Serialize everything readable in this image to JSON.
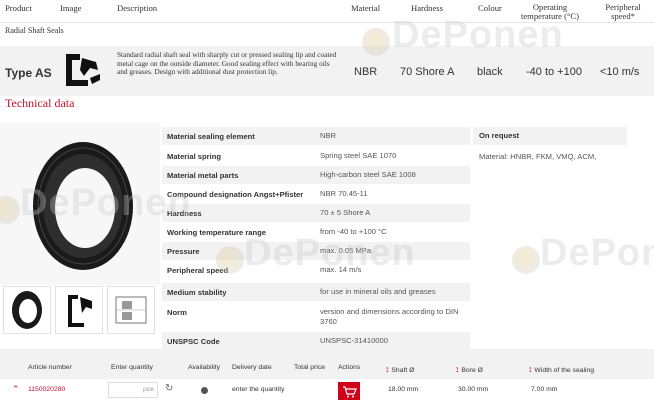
{
  "header": {
    "product": "Product",
    "image": "Image",
    "description": "Description",
    "material": "Material",
    "hardness": "Hardness",
    "colour": "Colour",
    "operating_temperature": "Operating temperature (°C)",
    "peripheral_speed": "Peripheral speed*"
  },
  "product": {
    "category": "Radial Shaft Seals",
    "type": "Type AS",
    "description": "Standard radial shaft seal with sharply cut or pressed sealing lip and coated metal cage on the outside diameter. Good sealing effect with bearing oils and greases. Design with additional dust protection lip.",
    "material": "NBR",
    "hardness": "70 Shore A",
    "colour": "black",
    "temperature": "-40 to +100",
    "speed": "<10 m/s"
  },
  "technical": {
    "title": "Technical data",
    "specs": [
      {
        "label": "Material sealing element",
        "value": "NBR"
      },
      {
        "label": "Material spring",
        "value": "Spring steel SAE 1070"
      },
      {
        "label": "Material metal parts",
        "value": "High-carbon steel SAE 1008"
      },
      {
        "label": "Compound designation Angst+Pfister",
        "value": "NBR 70.45-11"
      },
      {
        "label": "Hardness",
        "value": "70 ± 5 Shore A"
      },
      {
        "label": "Working temperature range",
        "value": "from -40 to +100 °C"
      },
      {
        "label": "Pressure",
        "value": "max. 0.05 MPa"
      },
      {
        "label": "Peripheral speed",
        "value": "max. 14 m/s"
      },
      {
        "label": "Medium stability",
        "value": "for use in mineral oils and greases"
      },
      {
        "label": "Norm",
        "value": "version and dimensions according to DIN 3760"
      },
      {
        "label": "UNSPSC Code",
        "value": "UNSPSC-31410000"
      }
    ],
    "on_request_title": "On request",
    "on_request_value": "Material: HNBR, FKM, VMQ, ACM,"
  },
  "table": {
    "headers": {
      "article_number": "Article number",
      "enter_quantity": "Enter quantity",
      "availability": "Availability",
      "delivery_date": "Delivery date",
      "total_price": "Total price",
      "actions": "Actions",
      "shaft": "Shaft Ø",
      "bore": "Bore Ø",
      "width": "Width of the sealing"
    },
    "row": {
      "article_number": "1150020280",
      "quantity_unit": "pce",
      "delivery": "enter the quantity",
      "shaft": "18.00 mm",
      "bore": "30.00 mm",
      "width": "7.00 mm"
    }
  },
  "watermark": "DePonen",
  "colors": {
    "accent": "#c8102e",
    "cart": "#d0021b"
  }
}
